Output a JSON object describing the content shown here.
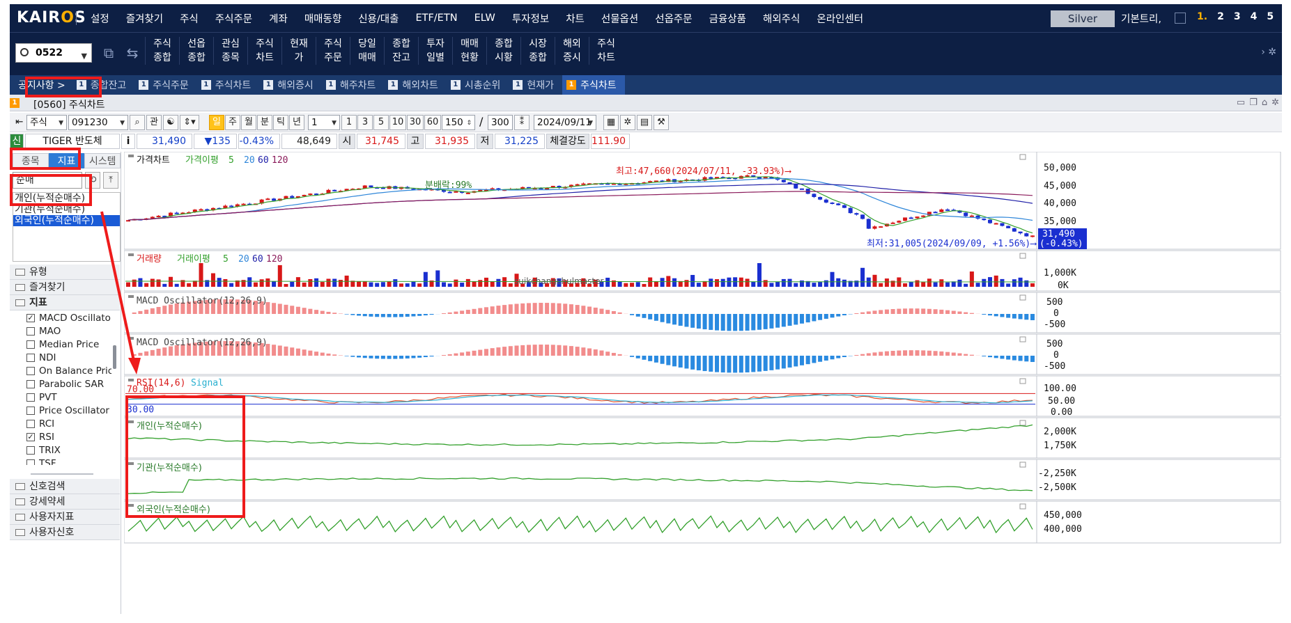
{
  "menubar": {
    "logo_left": "KAIR",
    "logo_o": "O",
    "logo_right": "S",
    "items": [
      "설정",
      "즐겨찾기",
      "주식",
      "주식주문",
      "계좌",
      "매매동향",
      "신용/대출",
      "ETF/ETN",
      "ELW",
      "투자정보",
      "차트",
      "선물옵션",
      "선옵주문",
      "금융상품",
      "해외주식",
      "온라인센터"
    ],
    "grade": "Silver",
    "basic": "기본트리,",
    "pages": [
      "1.",
      "2",
      "3",
      "4",
      "5"
    ]
  },
  "toolbar": {
    "code": "0522",
    "items": [
      "주식\n종합",
      "선옵\n종합",
      "관심\n종목",
      "주식\n차트",
      "현재\n가",
      "주식\n주문",
      "당일\n매매",
      "종합\n잔고",
      "투자\n일별",
      "매매\n현황",
      "종합\n시황",
      "시장\n종합",
      "해외\n증시",
      "주식\n차트"
    ]
  },
  "tabbar": {
    "notice": "공지사항 >",
    "tabs": [
      {
        "num": "1",
        "label": "종합잔고"
      },
      {
        "num": "1",
        "label": "주식주문"
      },
      {
        "num": "1",
        "label": "주식차트"
      },
      {
        "num": "1",
        "label": "해외증시"
      },
      {
        "num": "1",
        "label": "해주차트"
      },
      {
        "num": "1",
        "label": "해외차트"
      },
      {
        "num": "1",
        "label": "시총순위"
      },
      {
        "num": "1",
        "label": "현재가"
      },
      {
        "num": "1",
        "label": "주식차트"
      }
    ]
  },
  "window": {
    "num": "1",
    "title": "[0560] 주식차트"
  },
  "controls": {
    "market": "주식",
    "code": "091230",
    "btn_gwan": "관",
    "periods": [
      "일",
      "주",
      "월",
      "분",
      "틱",
      "년"
    ],
    "interval": "1",
    "intervals": [
      "1",
      "3",
      "5",
      "10",
      "30",
      "60"
    ],
    "count": "150",
    "total": "300",
    "slash": "/",
    "date": "2024/09/11"
  },
  "priceinfo": {
    "badge": "신",
    "name": "TIGER 반도체",
    "info": "i",
    "price": "31,490",
    "change": "▼135",
    "rate": "-0.43%",
    "volume": "48,649",
    "open_label": "시",
    "open": "31,745",
    "high_label": "고",
    "high": "31,935",
    "low_label": "저",
    "low": "31,225",
    "strength_label": "체결강도",
    "strength": "111.90"
  },
  "leftpanel": {
    "tabs": [
      "종목",
      "지표",
      "시스템"
    ],
    "search": "순매",
    "results": [
      "개인(누적순매수)",
      "기관(누적순매수)",
      "외국인(누적순매수)"
    ],
    "folders_top": [
      "유형",
      "즐겨찾기",
      "지표"
    ],
    "indicators": [
      {
        "name": "MACD Oscillator",
        "checked": true
      },
      {
        "name": "MAO",
        "checked": false
      },
      {
        "name": "Median Price",
        "checked": false
      },
      {
        "name": "NDI",
        "checked": false
      },
      {
        "name": "On Balance Price",
        "checked": false
      },
      {
        "name": "Parabolic SAR",
        "checked": false
      },
      {
        "name": "PVT",
        "checked": false
      },
      {
        "name": "Price Oscillator",
        "checked": false
      },
      {
        "name": "RCI",
        "checked": false
      },
      {
        "name": "RSI",
        "checked": true
      },
      {
        "name": "TRIX",
        "checked": false
      },
      {
        "name": "TSF",
        "checked": false
      }
    ],
    "folders_bottom": [
      "신호검색",
      "강세약세",
      "사용자지표",
      "사용자신호"
    ]
  },
  "chart": {
    "panes": {
      "price": {
        "title": "가격차트",
        "ma_label": "가격이평",
        "ma": [
          "5",
          "20",
          "60",
          "120"
        ],
        "axis": [
          "50,000",
          "45,000",
          "40,000",
          "35,000"
        ],
        "last_price": "31,490",
        "last_rate": "(-0.43%)",
        "high_note": "최고:47,660(2024/07/11, -33.93%)⟶",
        "low_note": "최저:31,005(2024/09/09, +1.56%)⟶",
        "div_note": "분배락:99%"
      },
      "volume": {
        "title": "거래량",
        "ma_label": "거래이평",
        "ma": [
          "5",
          "20",
          "60",
          "120"
        ],
        "axis": [
          "1,000K",
          "0K"
        ],
        "watermark": "suikchangchulmaster"
      },
      "macd1": {
        "title": "MACD Oscillator(12,26,9)",
        "axis": [
          "500",
          "0",
          "-500"
        ]
      },
      "macd2": {
        "title": "MACD Oscillator(12,26,9)",
        "axis": [
          "500",
          "0",
          "-500"
        ]
      },
      "rsi": {
        "title": "RSI(14,6)",
        "signal": "Signal",
        "axis": [
          "100.00",
          "50.00",
          "0.00"
        ],
        "upper": "70.00",
        "lower": "30.00"
      },
      "individual": {
        "title": "개인(누적순매수)",
        "axis": [
          "2,000K",
          "1,750K"
        ]
      },
      "institution": {
        "title": "기관(누적순매수)",
        "axis": [
          "-2,250K",
          "-2,500K"
        ]
      },
      "foreign": {
        "title": "외국인(누적순매수)",
        "axis": [
          "450,000",
          "400,000"
        ]
      }
    }
  },
  "colors": {
    "navy": "#0d1f44",
    "up": "#d81818",
    "down": "#1a2fd0",
    "ma5": "#33a02c",
    "ma20": "#2e86d9",
    "ma60": "#2020a8",
    "ma120": "#8a1a5a",
    "highlight": "#ee1b1b"
  }
}
